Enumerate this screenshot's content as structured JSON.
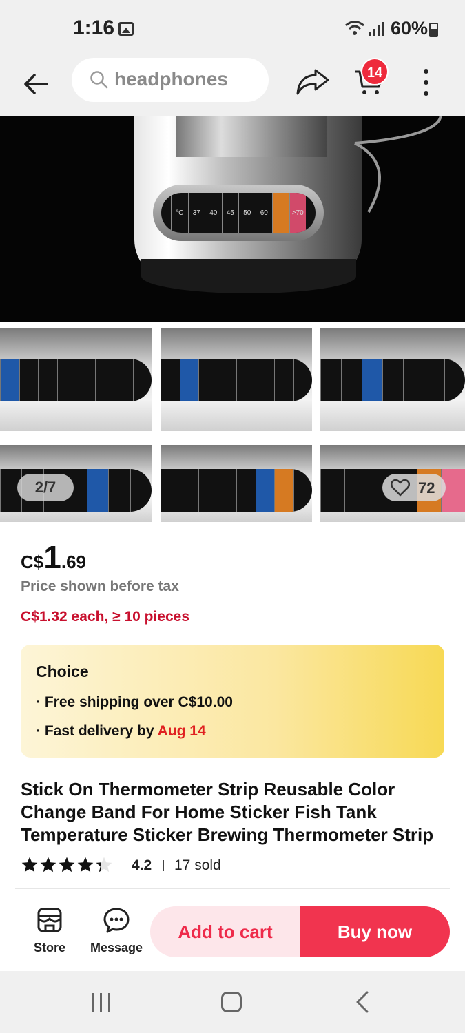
{
  "status_bar": {
    "time": "1:16",
    "battery": "60%"
  },
  "search": {
    "query": "headphones"
  },
  "cart": {
    "badge_count": "14"
  },
  "gallery": {
    "counter": "2/7",
    "favorite_count": "72",
    "strip_labels": [
      "°C",
      "37",
      "40",
      "45",
      "50",
      "60",
      ">70"
    ]
  },
  "price": {
    "currency": "C$",
    "whole": "1",
    "cents": ".69",
    "tax_note": "Price shown before tax",
    "bulk_offer": "C$1.32 each, ≥ 10 pieces"
  },
  "choice": {
    "title": "Choice",
    "shipping": "· Free shipping over C$10.00",
    "delivery_prefix": "· Fast delivery by ",
    "delivery_date": "Aug 14"
  },
  "product": {
    "title": "Stick On Thermometer Strip Reusable Color Change Band For Home Sticker Fish Tank Temperature Sticker Brewing Thermometer Strip",
    "rating": "4.2",
    "rating_value": 4.2,
    "sold": "17 sold"
  },
  "actions": {
    "store": "Store",
    "message": "Message",
    "add_to_cart": "Add to cart",
    "buy_now": "Buy now"
  },
  "colors": {
    "accent_red": "#f1344f",
    "badge_red": "#ee2a3c",
    "choice_gold": "#f7d954",
    "bulk_red": "#c8102e"
  }
}
